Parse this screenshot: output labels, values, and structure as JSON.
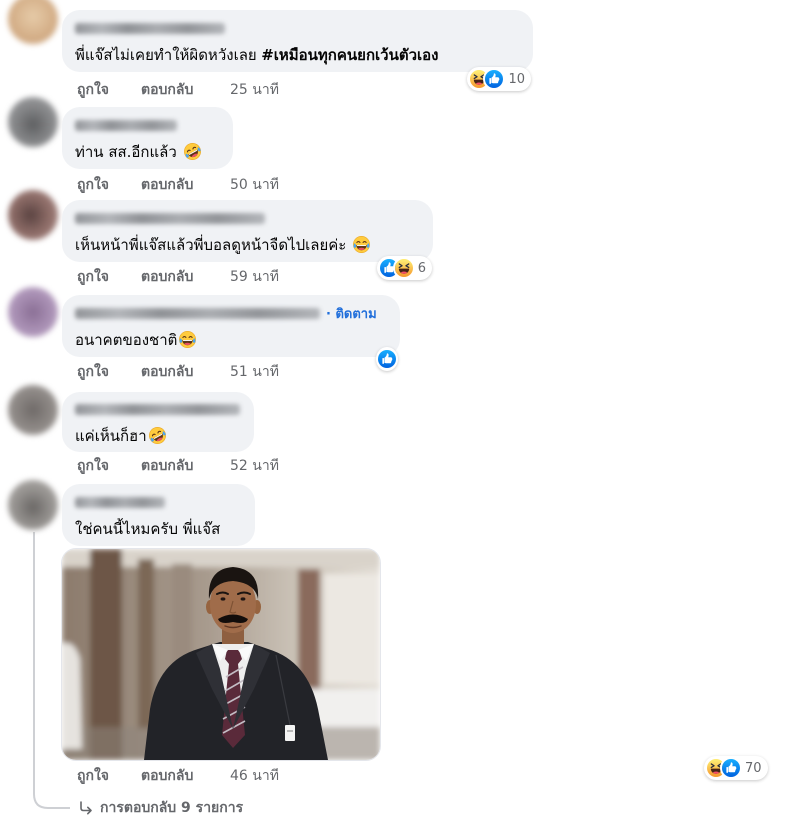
{
  "colors": {
    "bubble_background": "#f0f2f5",
    "primary_text": "#050505",
    "secondary_text": "#65676b",
    "link_blue": "#216fdb",
    "thread_line": "#ced0d4"
  },
  "comments": [
    {
      "text": "พี่แจ๊สไม่เคยทำให้ผิดหวังเลย",
      "hashtag": "#เหมือนทุกคนยกเว้นตัวเอง",
      "reactions": {
        "icons": [
          "haha",
          "like"
        ],
        "count": "10"
      },
      "like_label": "ถูกใจ",
      "reply_label": "ตอบกลับ",
      "time": "25 นาที"
    },
    {
      "text": "ท่าน สส.อีกแล้ว",
      "emoji": "rolling-on-floor-laughing",
      "like_label": "ถูกใจ",
      "reply_label": "ตอบกลับ",
      "time": "50 นาที"
    },
    {
      "text": "เห็นหน้าพี่แจ๊สแล้วพี่บอลดูหน้าจืดไปเลยค่ะ",
      "emoji": "face-with-tears-of-joy",
      "reactions": {
        "icons": [
          "like",
          "haha"
        ],
        "count": "6"
      },
      "like_label": "ถูกใจ",
      "reply_label": "ตอบกลับ",
      "time": "59 นาที"
    },
    {
      "follow_label": "· ติดตาม",
      "text": "อนาคตของชาติ",
      "emoji": "face-with-tears-of-joy",
      "reactions": {
        "icons": [
          "like"
        ]
      },
      "like_label": "ถูกใจ",
      "reply_label": "ตอบกลับ",
      "time": "51 นาที"
    },
    {
      "text": "แค่เห็นก็ฮา",
      "emoji": "rolling-on-floor-laughing",
      "like_label": "ถูกใจ",
      "reply_label": "ตอบกลับ",
      "time": "52 นาที"
    },
    {
      "text": "ใช่คนนี้ไหมครับ พี่แจ๊ส",
      "reactions": {
        "icons": [
          "haha",
          "like"
        ],
        "count": "70"
      },
      "like_label": "ถูกใจ",
      "reply_label": "ตอบกลับ",
      "time": "46 นาที"
    }
  ],
  "replies_link": "การตอบกลับ 9 รายการ"
}
